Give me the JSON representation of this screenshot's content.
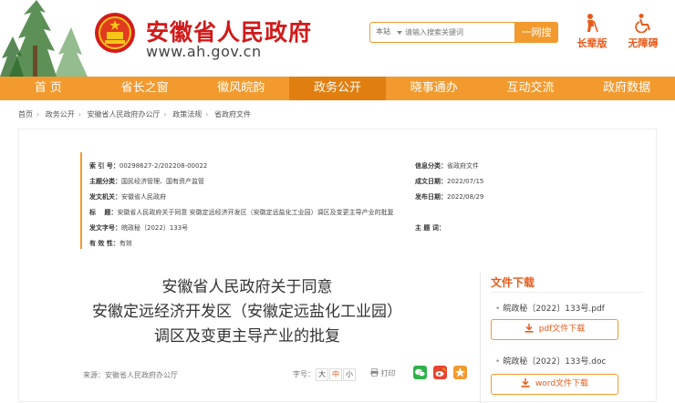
{
  "header": {
    "title": "安徽省人民政府",
    "url": "www.ah.gov.cn"
  },
  "search": {
    "scope": "本站",
    "placeholder": "请输入搜索关键词",
    "button": "一网搜"
  },
  "quick_links": [
    {
      "label": "长辈版",
      "icon": "elder-icon"
    },
    {
      "label": "无障碍",
      "icon": "accessibility-icon"
    }
  ],
  "nav": [
    {
      "label": "首 页"
    },
    {
      "label": "省长之窗"
    },
    {
      "label": "徽风皖韵"
    },
    {
      "label": "政务公开",
      "active": true
    },
    {
      "label": "晓事通办"
    },
    {
      "label": "互动交流"
    },
    {
      "label": "政府数据"
    }
  ],
  "breadcrumb": [
    "首页",
    "政务公开",
    "安徽省人民政府办公厅",
    "政策法规",
    "省政府文件"
  ],
  "meta": {
    "index_no_label": "索 引 号：",
    "index_no": "00298627-2/202208-00022",
    "category_label": "主题分类：",
    "category": "国民经济管理、国有资产监管",
    "issuer_label": "发文机关：",
    "issuer": "安徽省人民政府",
    "title_label": "标　 题：",
    "title": "安徽省人民政府关于同意 安徽定远经济开发区（安徽定远盐化工业园）调区及变更主导产业的批复",
    "doc_no_label": "发文字号：",
    "doc_no": "皖政秘〔2022〕133号",
    "validity_label": "有 效 性：",
    "validity": "有效",
    "source_type_label": "信息分类：",
    "source_type": "省政府文件",
    "created_label": "成文日期：",
    "created": "2022/07/15",
    "published_label": "发布日期：",
    "published": "2022/08/29",
    "keywords_label": "主 题 词："
  },
  "doc_title": [
    "安徽省人民政府关于同意",
    "安徽定远经济开发区（安徽定远盐化工业园）",
    "调区及变更主导产业的批复"
  ],
  "source_line": "来源：安徽省人民政府办公厅",
  "font_size": {
    "label": "字号：",
    "options": [
      "大",
      "中",
      "小"
    ],
    "selected": "中"
  },
  "print_label": "打印",
  "downloads": {
    "title": "文件下载",
    "files": [
      {
        "name": "皖政秘〔2022〕133号.pdf",
        "button": "pdf文件下载"
      },
      {
        "name": "皖政秘〔2022〕133号.doc",
        "button": "word文件下载"
      }
    ]
  },
  "colors": {
    "accent": "#f29a2e",
    "nav_active": "#e07f10",
    "brand_red": "#d11a1a"
  }
}
